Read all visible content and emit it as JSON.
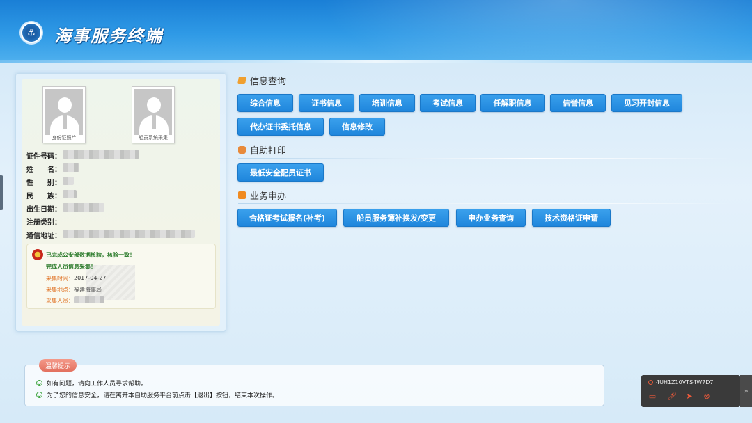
{
  "header": {
    "title": "海事服务终端",
    "logo_icon": "anchor-emblem-icon"
  },
  "profile": {
    "photo_captions": [
      "身份证照片",
      "船员系统采集"
    ],
    "fields": [
      {
        "label": "证件号码："
      },
      {
        "label": "姓　　名："
      },
      {
        "label": "性　　别："
      },
      {
        "label": "民　　族："
      },
      {
        "label": "出生日期："
      },
      {
        "label": "注册类别："
      },
      {
        "label": "通信地址："
      }
    ],
    "verification": {
      "line1": "已完成公安部数据核验，核验一致！",
      "line2": "完成人员信息采集！",
      "time_label": "采集时间：",
      "time_value": "2017-04-27",
      "place_label": "采集地点：",
      "place_value": "福建海事局",
      "person_label": "采集人员："
    }
  },
  "sections": {
    "query": {
      "title": "信息查询",
      "buttons": [
        "综合信息",
        "证书信息",
        "培训信息",
        "考试信息",
        "任解职信息",
        "信誉信息",
        "见习开封信息",
        "代办证书委托信息",
        "信息修改"
      ]
    },
    "print": {
      "title": "自助打印",
      "buttons": [
        "最低安全配员证书"
      ]
    },
    "business": {
      "title": "业务申办",
      "buttons": [
        "合格证考试报名(补考)",
        "船员服务簿补换发/变更",
        "申办业务查询",
        "技术资格证申请"
      ]
    }
  },
  "tips": {
    "tag": "温馨提示",
    "lines": [
      "如有问题，请向工作人员寻求帮助。",
      "为了您的信息安全，请在离开本自助服务平台前点击【退出】按钮，结束本次操作。"
    ]
  },
  "remote": {
    "session_id": "4UH1Z10VTS4W7D7",
    "icons": [
      "chat-icon",
      "microphone-icon",
      "cursor-icon",
      "close-circle-icon"
    ],
    "accent": "#f05a3a"
  },
  "colors": {
    "header_blue": "#1a7fd6",
    "button_blue": "#1f86dc",
    "section_orange": "#f0a030"
  }
}
